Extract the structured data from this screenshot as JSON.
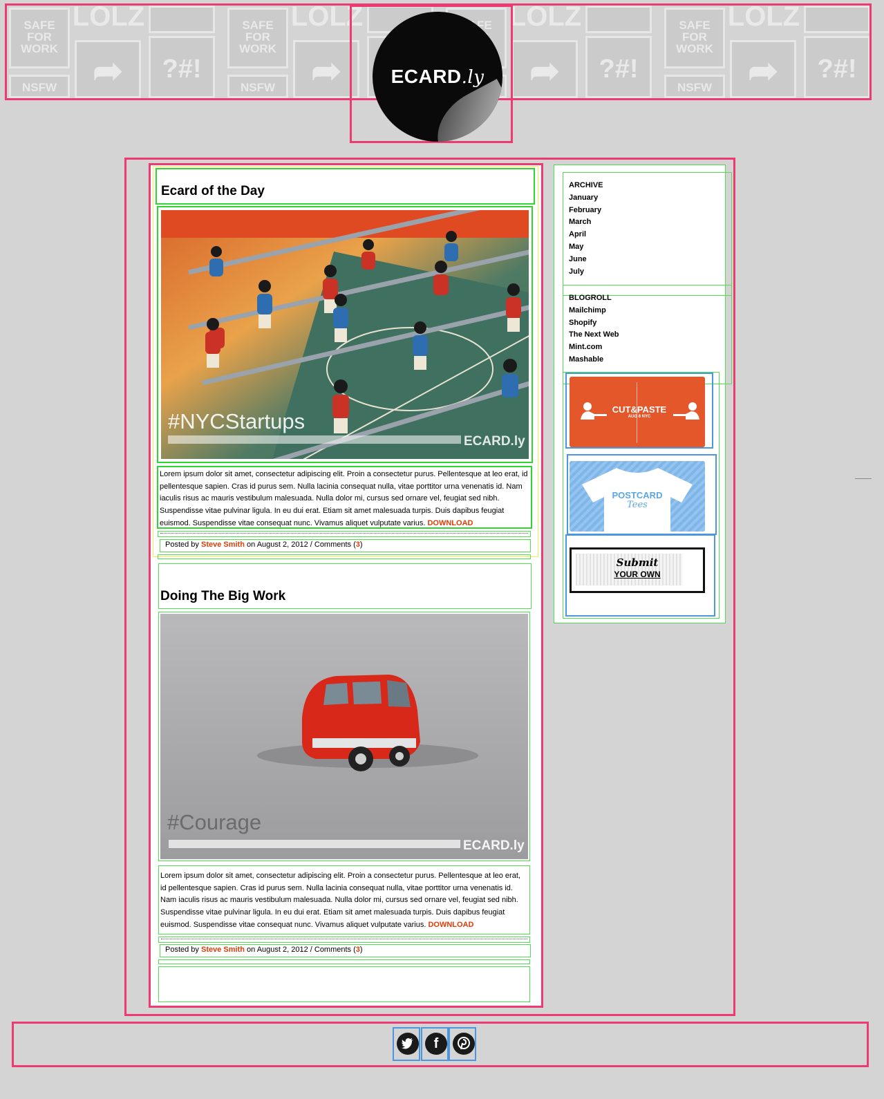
{
  "header": {
    "logo_text": "ECARD",
    "logo_suffix": ".ly",
    "tile_labels": {
      "sfw": [
        "SAFE",
        "FOR",
        "WORK"
      ],
      "lolz": "LOLZ",
      "nsfw": "NSFW",
      "symbols": "?#!"
    }
  },
  "posts": [
    {
      "title": "Ecard of the Day",
      "hashtag": "#NYCStartups",
      "watermark": "ECARD.ly",
      "body": "Lorem ipsum dolor sit amet, consectetur adipiscing elit. Proin a consectetur purus. Pellentesque at leo erat, id pellentesque sapien. Cras id purus sem. Nulla lacinia consequat nulla, vitae porttitor urna venenatis id. Nam iaculis risus ac mauris vestibulum malesuada. Nulla dolor mi, cursus sed ornare vel, feugiat sed nibh. Suspendisse vitae pulvinar ligula. In eu dui erat. Etiam sit amet malesuada turpis. Duis dapibus feugiat euismod. Suspendisse vitae consequat nunc. Vivamus aliquet vulputate varius.",
      "download_label": "DOWNLOAD",
      "byline_prefix": "Posted by",
      "author": "Steve Smith",
      "byline_mid": "on August 2, 2012 / Comments (",
      "comments": "3",
      "byline_suffix": ")"
    },
    {
      "title": "Doing The Big Work",
      "hashtag": "#Courage",
      "watermark": "ECARD.ly",
      "body": "Lorem ipsum dolor sit amet, consectetur adipiscing elit. Proin a consectetur purus. Pellentesque at leo erat, id pellentesque sapien. Cras id purus sem. Nulla lacinia consequat nulla, vitae porttitor urna venenatis id. Nam iaculis risus ac mauris vestibulum malesuada. Nulla dolor mi, cursus sed ornare vel, feugiat sed nibh. Suspendisse vitae pulvinar ligula. In eu dui erat. Etiam sit amet malesuada turpis. Duis dapibus feugiat euismod. Suspendisse vitae consequat nunc. Vivamus aliquet vulputate varius.",
      "download_label": "DOWNLOAD",
      "byline_prefix": "Posted by",
      "author": "Steve Smith",
      "byline_mid": "on August 2, 2012 / Comments (",
      "comments": "3",
      "byline_suffix": ")"
    }
  ],
  "sidebar": {
    "archive": {
      "heading": "ARCHIVE",
      "items": [
        "January",
        "February",
        "March",
        "April",
        "May",
        "June",
        "July"
      ]
    },
    "blogroll": {
      "heading": "BLOGROLL",
      "items": [
        "Mailchimp",
        "Shopify",
        "The Next Web",
        "Mint.com",
        "Mashable"
      ]
    },
    "ads": {
      "cutpaste": {
        "title": "CUT&PASTE",
        "sub": "AUG 8 NYC"
      },
      "postcard": {
        "title": "POSTCARD",
        "sub": "Tees"
      },
      "submit": {
        "title": "Submit",
        "sub": "YOUR OWN"
      }
    }
  },
  "footer": {
    "social": [
      {
        "name": "twitter",
        "glyph": "t"
      },
      {
        "name": "facebook",
        "glyph": "f"
      },
      {
        "name": "pinterest",
        "glyph": "p"
      }
    ]
  },
  "colors": {
    "accent": "#e23c05",
    "frame_pink": "#ee3a72",
    "frame_green": "#2fd62f",
    "frame_blue": "#4a96e0",
    "bg": "#d4d4d4"
  }
}
